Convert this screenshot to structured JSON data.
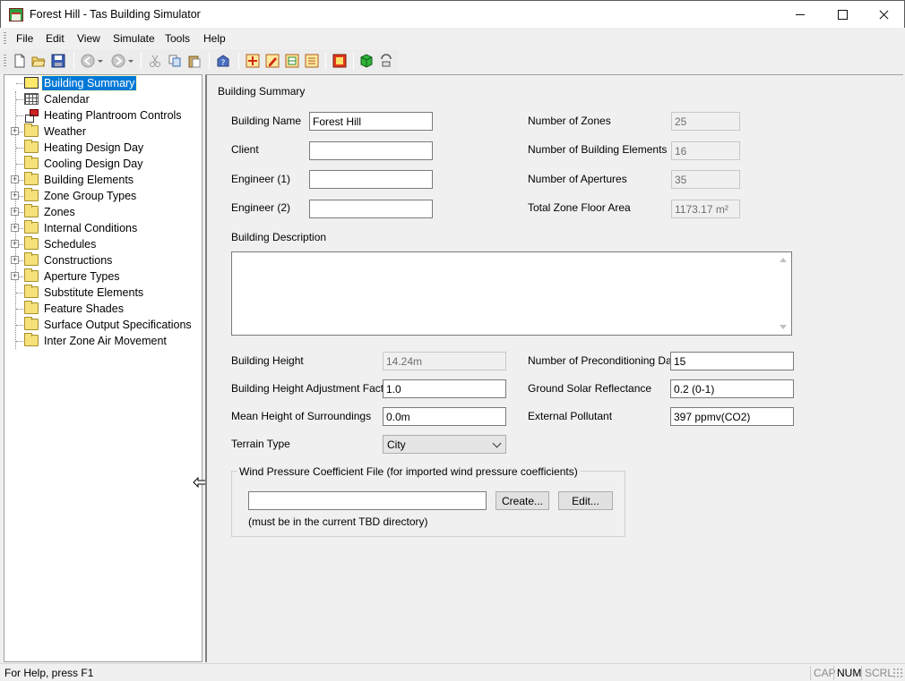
{
  "window": {
    "title": "Forest Hill - Tas Building Simulator"
  },
  "menu": [
    "File",
    "Edit",
    "View",
    "Simulate",
    "Tools",
    "Help"
  ],
  "toolbar": {
    "icons": [
      "new-file-icon",
      "open-folder-icon",
      "save-icon",
      "back-icon",
      "forward-icon",
      "cut-icon",
      "copy-icon",
      "paste-icon",
      "help-icon",
      "calculate-icon",
      "edit-report-icon",
      "table-icon",
      "list-icon",
      "simulate-icon",
      "cube-icon",
      "rotate-icon"
    ]
  },
  "tree": {
    "items": [
      {
        "label": "Building Summary",
        "icon": "house-icon",
        "expandable": false,
        "selected": true
      },
      {
        "label": "Calendar",
        "icon": "calendar-icon",
        "expandable": false
      },
      {
        "label": "Heating Plantroom Controls",
        "icon": "plant-control-icon",
        "expandable": false
      },
      {
        "label": "Weather",
        "icon": "folder-icon",
        "expandable": true
      },
      {
        "label": "Heating Design Day",
        "icon": "folder-icon",
        "expandable": false
      },
      {
        "label": "Cooling Design Day",
        "icon": "folder-icon",
        "expandable": false
      },
      {
        "label": "Building Elements",
        "icon": "folder-icon",
        "expandable": true
      },
      {
        "label": "Zone Group Types",
        "icon": "folder-icon",
        "expandable": true
      },
      {
        "label": "Zones",
        "icon": "folder-icon",
        "expandable": true
      },
      {
        "label": "Internal Conditions",
        "icon": "folder-icon",
        "expandable": true
      },
      {
        "label": "Schedules",
        "icon": "folder-icon",
        "expandable": true
      },
      {
        "label": "Constructions",
        "icon": "folder-icon",
        "expandable": true
      },
      {
        "label": "Aperture Types",
        "icon": "folder-icon",
        "expandable": true
      },
      {
        "label": "Substitute Elements",
        "icon": "folder-icon",
        "expandable": false
      },
      {
        "label": "Feature Shades",
        "icon": "folder-icon",
        "expandable": false
      },
      {
        "label": "Surface Output Specifications",
        "icon": "folder-icon",
        "expandable": false
      },
      {
        "label": "Inter Zone Air Movement",
        "icon": "folder-icon",
        "expandable": false
      }
    ]
  },
  "summary": {
    "title": "Building Summary",
    "building_name": {
      "label": "Building Name",
      "value": "Forest Hill"
    },
    "client": {
      "label": "Client",
      "value": ""
    },
    "engineer1": {
      "label": "Engineer (1)",
      "value": ""
    },
    "engineer2": {
      "label": "Engineer (2)",
      "value": ""
    },
    "num_zones": {
      "label": "Number of Zones",
      "value": "25"
    },
    "num_elements": {
      "label": "Number of Building Elements",
      "value": "16"
    },
    "num_apertures": {
      "label": "Number of Apertures",
      "value": "35"
    },
    "floor_area": {
      "label": "Total Zone Floor Area",
      "value": "1173.17 m²"
    },
    "description": {
      "label": "Building Description",
      "value": ""
    },
    "height": {
      "label": "Building Height",
      "value": "14.24m"
    },
    "height_adj": {
      "label": "Building Height Adjustment Factor",
      "value": "1.0"
    },
    "mean_height": {
      "label": "Mean Height of Surroundings",
      "value": "0.0m"
    },
    "terrain": {
      "label": "Terrain Type",
      "value": "City"
    },
    "precond_days": {
      "label": "Number of Preconditioning Days",
      "value": "15"
    },
    "ground_reflect": {
      "label": "Ground Solar Reflectance",
      "value": "0.2 (0-1)"
    },
    "pollutant": {
      "label": "External Pollutant",
      "value": "397 ppmv(CO2)"
    },
    "wind": {
      "legend": "Wind Pressure Coefficient File (for imported wind pressure coefficients)",
      "file_value": "",
      "create_label": "Create...",
      "edit_label": "Edit...",
      "note": "(must be in the current TBD directory)"
    }
  },
  "status": {
    "help_text": "For Help, press F1",
    "cap": "CAP",
    "num": "NUM",
    "scrl": "SCRL"
  },
  "colors": {
    "selection": "#0078d7",
    "folder": "#f5e07a"
  }
}
